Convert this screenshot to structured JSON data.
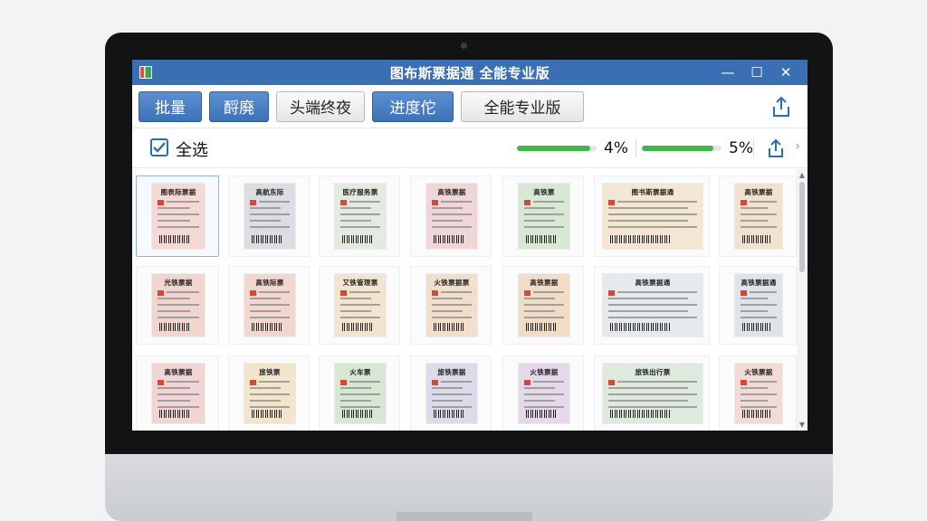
{
  "window": {
    "title": "图布斯票据通 全能专业版",
    "controls": {
      "minimize": "—",
      "maximize": "☐",
      "close": "✕"
    }
  },
  "toolbar": {
    "buttons": [
      {
        "label": "批量",
        "style": "blue"
      },
      {
        "label": "酹廃",
        "style": "blue"
      },
      {
        "label": "头端终夜",
        "style": "gray"
      },
      {
        "label": "进度佗",
        "style": "blue"
      },
      {
        "label": "全能专业版",
        "style": "gray"
      }
    ],
    "share_icon": "share-icon"
  },
  "status": {
    "select_all_label": "全选",
    "select_all_checked": true,
    "progress": [
      {
        "percent_label": "4%",
        "fill": 0.92
      },
      {
        "percent_label": "5%",
        "fill": 0.9
      }
    ]
  },
  "colors": {
    "titlebar": "#3b6fb4",
    "button_blue": "#4a80c4",
    "progress_green": "#3fb54a",
    "checkbox_blue": "#2e6db4"
  },
  "tickets": [
    [
      {
        "title": "图表际票据",
        "tint": "#f4d9d6",
        "selected": true
      },
      {
        "title": "高航东际",
        "tint": "#dcdde3"
      },
      {
        "title": "医疗服务票",
        "tint": "#e3eadf"
      },
      {
        "title": "高铁票据",
        "tint": "#f0d6d6"
      },
      {
        "title": "高铁票",
        "tint": "#d9e8d4"
      },
      {
        "title": "图书斯票据通",
        "tint": "#f3e6d2",
        "wide": true
      },
      {
        "title": "高铁票据",
        "tint": "#f3e1cf"
      }
    ],
    [
      {
        "title": "光铁票据",
        "tint": "#f1d6cf"
      },
      {
        "title": "高铁际票",
        "tint": "#f1d7cd"
      },
      {
        "title": "又铁管理票",
        "tint": "#f3e4cf"
      },
      {
        "title": "火铁票据票",
        "tint": "#f1dfcc"
      },
      {
        "title": "高铁票据",
        "tint": "#f1ddc7"
      },
      {
        "title": "高铁票据通",
        "tint": "#e6eaee",
        "wide": true
      },
      {
        "title": "高铁票据通",
        "tint": "#dfe3ea"
      }
    ],
    [
      {
        "title": "高铁票据",
        "tint": "#f1d4d4"
      },
      {
        "title": "旅铁票",
        "tint": "#f3e5cc"
      },
      {
        "title": "火车票",
        "tint": "#d8e6d4"
      },
      {
        "title": "旅铁票据",
        "tint": "#dcdbe9"
      },
      {
        "title": "火铁票据",
        "tint": "#e5d9e9"
      },
      {
        "title": "旅铁出行票",
        "tint": "#dfeadf",
        "wide": true
      },
      {
        "title": "火铁票据",
        "tint": "#f1dbd6"
      }
    ]
  ]
}
